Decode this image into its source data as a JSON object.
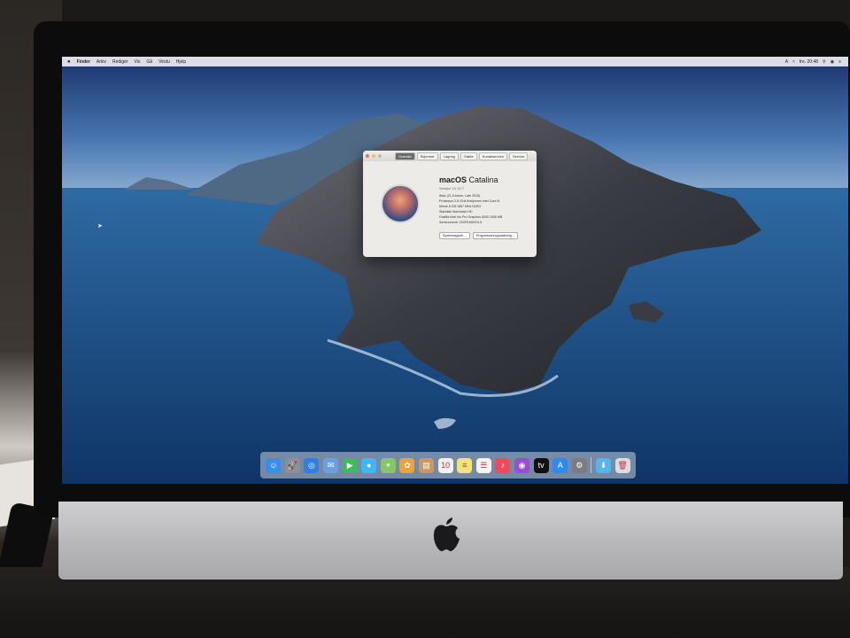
{
  "menubar": {
    "apple": "",
    "items": [
      "Finder",
      "Arkiv",
      "Redigér",
      "Vis",
      "Gå",
      "Vindu",
      "Hjelp"
    ],
    "clock": "fre. 20:48"
  },
  "about_window": {
    "tabs": [
      "Oversikt",
      "Skjermer",
      "Lagring",
      "Støtte",
      "Kundeservice",
      "Service"
    ],
    "title_bold": "macOS",
    "title_rest": " Catalina",
    "version": "Versjon 10.15.7",
    "specs": [
      "iMac (21,5-tomm, Late 2015)",
      "Prosessor   2,8 GHz firekjernes Intel Core i5",
      "Minne   8 GB 1867 MHz DDR3",
      "Startdisk   Macintosh HD",
      "Grafikk   Intel Iris Pro Graphics 6200 1536 MB",
      "Serienummer   C02R1M0VGL5"
    ],
    "buttons": [
      "Systemrapport…",
      "Programvareoppdatering…"
    ]
  },
  "dock": {
    "apps": [
      {
        "name": "finder-icon",
        "glyph": "☺",
        "color": "#3a8ee6"
      },
      {
        "name": "launchpad-icon",
        "glyph": "🚀",
        "color": "#8a8f99"
      },
      {
        "name": "safari-icon",
        "glyph": "◎",
        "color": "#2f7fe0"
      },
      {
        "name": "mail-icon",
        "glyph": "✉",
        "color": "#6aa0dc"
      },
      {
        "name": "facetime-icon",
        "glyph": "▶",
        "color": "#3dbd55"
      },
      {
        "name": "messages-icon",
        "glyph": "●",
        "color": "#3fb7f0"
      },
      {
        "name": "maps-icon",
        "glyph": "⌖",
        "color": "#88c765"
      },
      {
        "name": "photos-icon",
        "glyph": "✿",
        "color": "#f2a03a"
      },
      {
        "name": "contacts-icon",
        "glyph": "▤",
        "color": "#c79a5d"
      },
      {
        "name": "calendar-icon",
        "glyph": "10",
        "color": "#f1f1f1"
      },
      {
        "name": "notes-icon",
        "glyph": "≡",
        "color": "#f7e27a"
      },
      {
        "name": "reminders-icon",
        "glyph": "☰",
        "color": "#f4f4f4"
      },
      {
        "name": "music-icon",
        "glyph": "♪",
        "color": "#f24a5c"
      },
      {
        "name": "podcasts-icon",
        "glyph": "◉",
        "color": "#9a4cd8"
      },
      {
        "name": "appletv-icon",
        "glyph": "tv",
        "color": "#111111"
      },
      {
        "name": "appstore-icon",
        "glyph": "A",
        "color": "#2f8bef"
      },
      {
        "name": "system-preferences-icon",
        "glyph": "⚙",
        "color": "#7c7c80"
      }
    ],
    "trailing": [
      {
        "name": "downloads-folder-icon",
        "glyph": "⬇",
        "color": "#58b4e8"
      },
      {
        "name": "trash-icon",
        "glyph": "🗑",
        "color": "#d9dde2"
      }
    ]
  }
}
